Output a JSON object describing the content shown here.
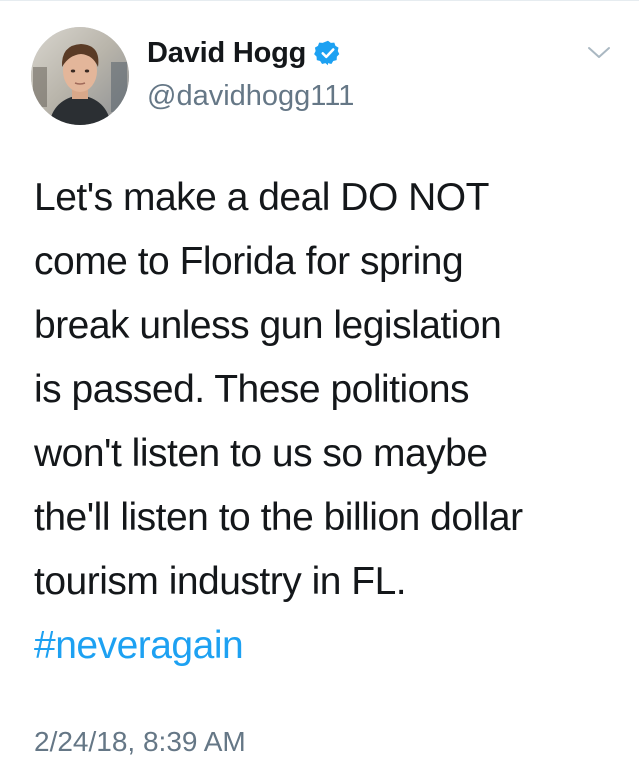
{
  "tweet": {
    "author": {
      "name": "David Hogg",
      "handle": "@davidhogg111",
      "verified": true,
      "verified_color": "#1da1f2"
    },
    "text_lines": [
      "Let's make a deal DO NOT",
      "come to Florida for spring",
      "break unless gun legislation",
      "is passed. These politions",
      "won't listen to us so maybe",
      "the'll listen to the billion dollar",
      "tourism industry in FL."
    ],
    "hashtag": "#neveragain",
    "hashtag_color": "#1da1f2",
    "timestamp": "2/24/18, 8:39 AM",
    "menu_icon": "chevron-down-icon"
  }
}
